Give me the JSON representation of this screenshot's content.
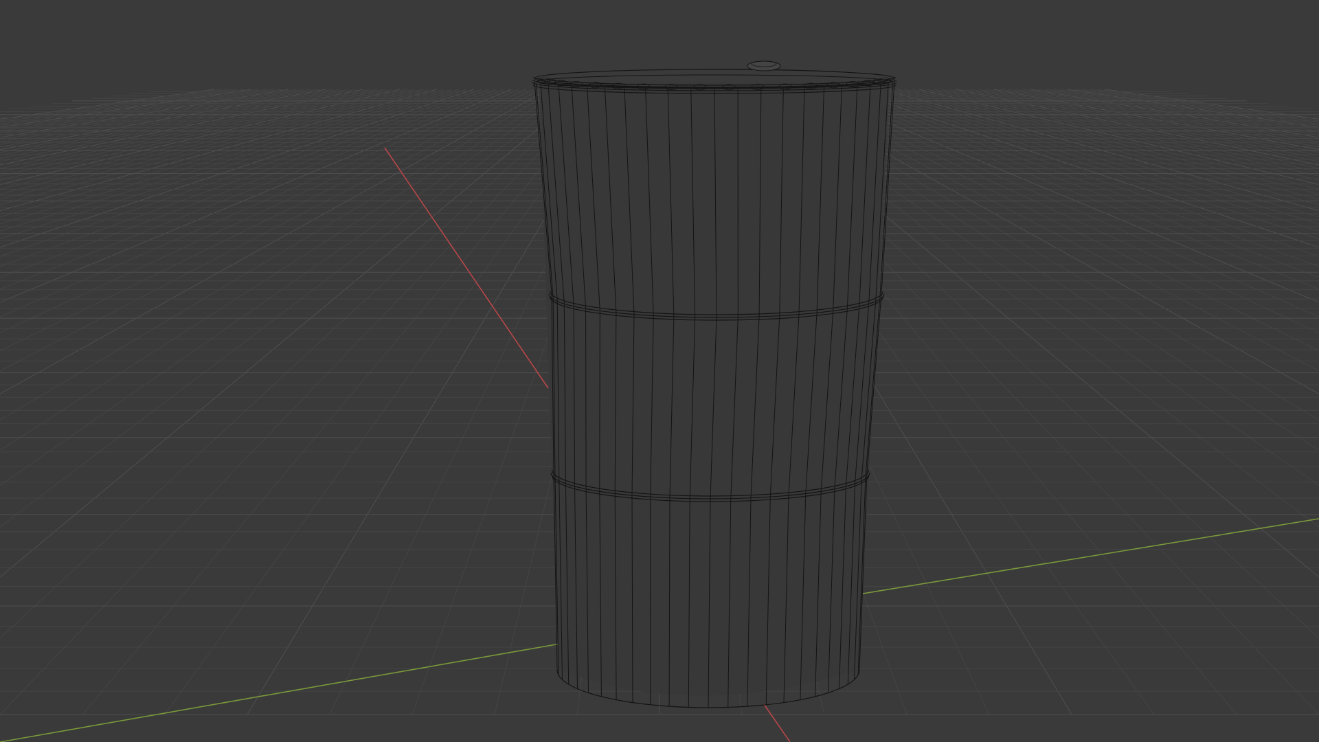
{
  "viewport": {
    "shading_mode": "wireframe",
    "object": "barrel",
    "colors": {
      "background": "#3a3a3a",
      "grid_line": "#4f4f4f",
      "grid_line_faint": "#444444",
      "x_axis": "#b8474a",
      "y_axis": "#7a9a3a",
      "wire": "#141414",
      "wire_fill": "#383838"
    }
  }
}
